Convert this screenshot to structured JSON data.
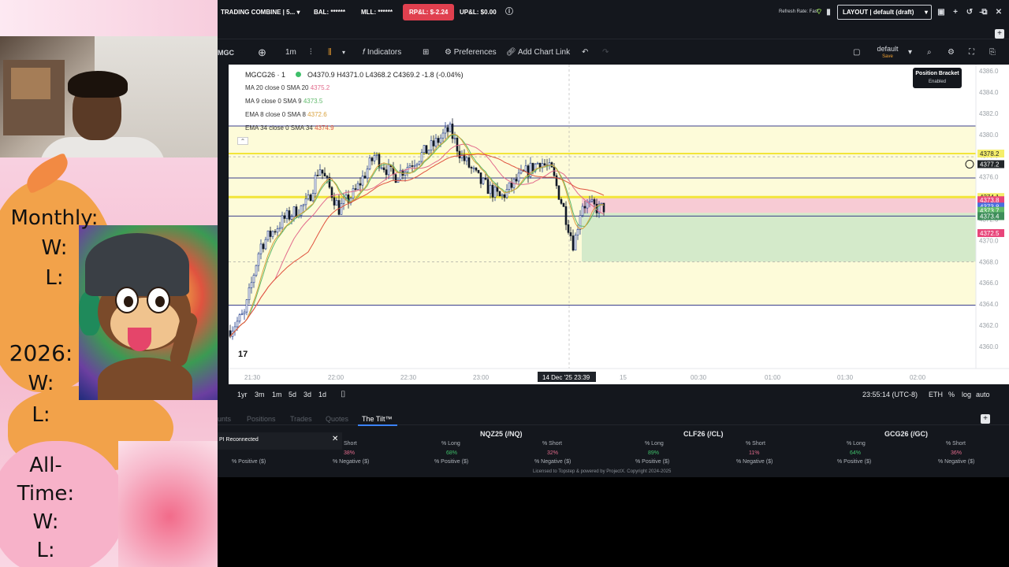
{
  "overlay": {
    "monthly_label": "Monthly:",
    "monthly_w": "W:",
    "monthly_l": "L:",
    "year_label": "2026:",
    "year_w": "W:",
    "year_l": "L:",
    "alltime_label1": "All-",
    "alltime_label2": "Time:",
    "alltime_w": "W:",
    "alltime_l": "L:"
  },
  "topbar": {
    "account": "TRADING COMBINE | 5...",
    "bal": "BAL: ******",
    "mll": "MLL: ******",
    "rpl": "RP&L: $-2.24",
    "upl": "UP&L: $0.00",
    "refresh": "Refresh Rate: Fast",
    "layout": "LAYOUT | default (draft)",
    "rpl_color": "#e0404f"
  },
  "toolbar": {
    "symbol": "MGC",
    "interval": "1m",
    "indicators": "Indicators",
    "preferences": "Preferences",
    "add_chart_link": "Add Chart Link",
    "template_name": "default",
    "template_sub": "Save"
  },
  "chart": {
    "symbol_line": "MGCG26 · 1",
    "ohlc": "O4370.9  H4371.0  L4368.2  C4369.2  -1.8 (-0.04%)",
    "legend": [
      {
        "name": "MA 20 close 0 SMA 20",
        "value": "4375.2",
        "color": "#e26b8c"
      },
      {
        "name": "MA 9 close 0 SMA 9",
        "value": "4373.5",
        "color": "#5fb96a"
      },
      {
        "name": "EMA 8 close 0 SMA 8",
        "value": "4372.6",
        "color": "#d9a23e"
      },
      {
        "name": "EMA 34 close 0 SMA 34",
        "value": "4374.9",
        "color": "#e0533f"
      }
    ],
    "position_bracket": "Position Bracket",
    "position_bracket_state": "Enabled",
    "price_axis": [
      "4386.0",
      "4384.0",
      "4382.0",
      "4380.0",
      "4378.0",
      "4376.0",
      "4374.0",
      "4372.0",
      "4370.0",
      "4368.0",
      "4366.0",
      "4364.0",
      "4362.0",
      "4360.0"
    ],
    "price_tags": [
      {
        "label": "4378.2",
        "bg": "#f5ee6a",
        "fg": "#222"
      },
      {
        "label": "4377.2",
        "bg": "#222629",
        "fg": "#fff"
      },
      {
        "label": "4374.1",
        "bg": "#f5ee6a",
        "fg": "#222"
      },
      {
        "label": "4373.8",
        "bg": "#e8457a",
        "fg": "#fff"
      },
      {
        "label": "4373.8",
        "bg": "#4a6ee0",
        "fg": "#fff"
      },
      {
        "label": "4373.7",
        "bg": "#5fb96a",
        "fg": "#fff"
      },
      {
        "label": "4373.4",
        "bg": "#3e8e5a",
        "fg": "#fff"
      },
      {
        "label": "4372.5",
        "bg": "#e8457a",
        "fg": "#fff"
      }
    ],
    "time_axis": [
      "21:30",
      "22:00",
      "22:30",
      "23:00",
      "14 Dec '25   23:39",
      "15",
      "00:30",
      "01:00",
      "01:30",
      "02:00"
    ]
  },
  "bottom": {
    "ranges": [
      "1yr",
      "3m",
      "1m",
      "5d",
      "3d",
      "1d"
    ],
    "clock": "23:55:14 (UTC-8)",
    "session": "ETH",
    "pct": "%",
    "log": "log",
    "auto": "auto"
  },
  "panel": {
    "tabs": [
      "unts",
      "Positions",
      "Trades",
      "Quotes",
      "The Tilt™"
    ],
    "notice": "PI Reconnected",
    "instruments": [
      "NQZ25 (/NQ)",
      "CLF26 (/CL)",
      "GCG26 (/GC)"
    ],
    "row1": [
      {
        "label": "Short",
        "value": "38%"
      },
      {
        "label": "% Long",
        "value": "68%"
      },
      {
        "label": "% Short",
        "value": "32%"
      },
      {
        "label": "% Long",
        "value": "89%"
      },
      {
        "label": "% Short",
        "value": "11%"
      },
      {
        "label": "% Long",
        "value": "64%"
      },
      {
        "label": "% Short",
        "value": "36%"
      }
    ],
    "row2": [
      "% Positive ($)",
      "% Negative ($)",
      "% Positive ($)",
      "% Negative ($)",
      "% Positive ($)",
      "% Negative ($)",
      "% Positive ($)",
      "% Negative ($)"
    ],
    "footer": "Licensed to Topstep & powered by ProjectX. Copyright 2024-2025"
  }
}
